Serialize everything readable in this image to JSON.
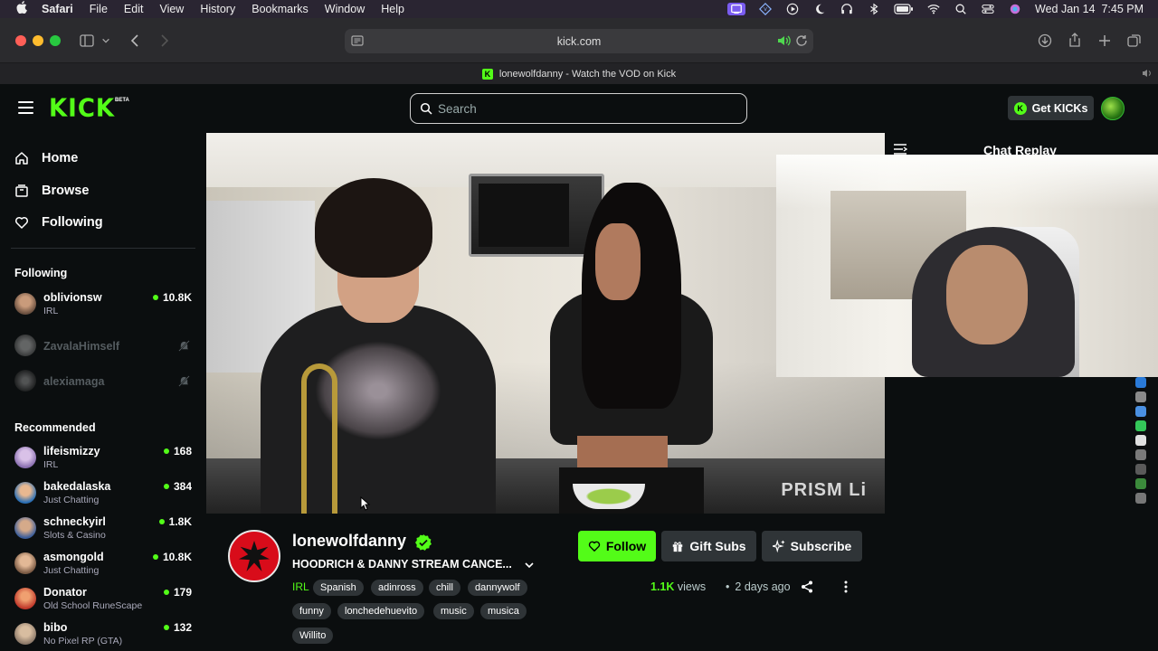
{
  "menubar": {
    "app": "Safari",
    "items": [
      "File",
      "Edit",
      "View",
      "History",
      "Bookmarks",
      "Window",
      "Help"
    ],
    "status_icons": [
      "screen-mirror-icon",
      "vpn-icon",
      "play-icon",
      "moon-icon",
      "headphones-icon",
      "bluetooth-icon",
      "battery-icon",
      "wifi-icon",
      "search-icon",
      "control-center-icon",
      "siri-icon"
    ],
    "datetime": "Wed Jan 14  7:45 PM"
  },
  "browser": {
    "url": "kick.com",
    "tab_title": "lonewolfdanny - Watch the VOD on Kick"
  },
  "header": {
    "logo": "KICK",
    "logo_badge": "BETA",
    "search_placeholder": "Search",
    "get_kicks_label": "Get KICKs"
  },
  "sidebar": {
    "nav": [
      {
        "label": "Home",
        "icon": "home-icon"
      },
      {
        "label": "Browse",
        "icon": "browse-icon"
      },
      {
        "label": "Following",
        "icon": "heart-icon"
      }
    ],
    "following_title": "Following",
    "following": [
      {
        "name": "oblivionsw",
        "category": "IRL",
        "viewers": "10.8K",
        "live": true,
        "color": "#6b5040"
      },
      {
        "name": "ZavalaHimself",
        "category": "",
        "viewers": "",
        "live": false,
        "color": "#888888"
      },
      {
        "name": "alexiamaga",
        "category": "",
        "viewers": "",
        "live": false,
        "color": "#777777"
      }
    ],
    "recommended_title": "Recommended",
    "recommended": [
      {
        "name": "lifeismizzy",
        "category": "IRL",
        "viewers": "168",
        "color": "#8a6fb0"
      },
      {
        "name": "bakedalaska",
        "category": "Just Chatting",
        "viewers": "384",
        "color": "#2a6fb5"
      },
      {
        "name": "schneckyirl",
        "category": "Slots & Casino",
        "viewers": "1.8K",
        "color": "#3b5d9a"
      },
      {
        "name": "asmongold",
        "category": "Just Chatting",
        "viewers": "10.8K",
        "color": "#c78a60"
      },
      {
        "name": "Donator",
        "category": "Old School RuneScape",
        "viewers": "179",
        "color": "#c0392b"
      },
      {
        "name": "bibo",
        "category": "No Pixel RP (GTA)",
        "viewers": "132",
        "color": "#8d7a6a"
      }
    ]
  },
  "video": {
    "watermark": "PRISM Li"
  },
  "chat": {
    "title": "Chat Replay"
  },
  "stream": {
    "channel": "lonewolfdanny",
    "title": "HOODRICH & DANNY STREAM CANCE...",
    "category": "IRL",
    "tags": [
      "Spanish",
      "adinross",
      "chill",
      "dannywolf",
      "funny",
      "lonchedehuevito",
      "music",
      "musica",
      "Willito"
    ],
    "views_value": "1.1K",
    "views_label": "views",
    "ago": "2 days ago",
    "follow_label": "Follow",
    "gift_label": "Gift Subs",
    "subscribe_label": "Subscribe"
  },
  "colors": {
    "accent": "#53fc18",
    "background": "#0b0e0f",
    "button_dark": "#2f3437"
  }
}
